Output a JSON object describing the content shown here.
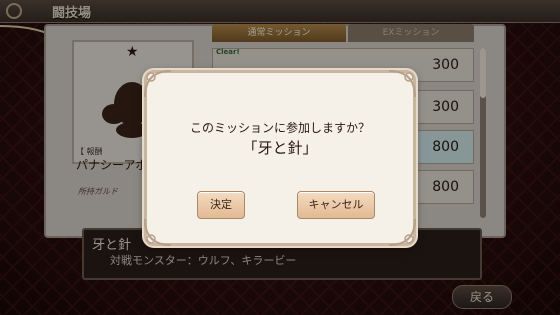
{
  "header": {
    "title": "闘技場"
  },
  "card": {
    "reward_label": "【 報酬",
    "reward_name": "パナシーアボ",
    "guild_label": "所持ガルド"
  },
  "tabs": [
    {
      "label": "通常ミッション"
    },
    {
      "label": "EXミッション"
    }
  ],
  "cleared_label": "Clear!",
  "missions": [
    {
      "value": "300"
    },
    {
      "value": "300"
    },
    {
      "value": "800"
    },
    {
      "value": "800"
    }
  ],
  "info": {
    "title": "牙と針",
    "description": "対戦モンスター：ウルフ、キラービー"
  },
  "back_button": "戻る",
  "dialog": {
    "question": "このミッションに参加しますか？",
    "mission_name": "「牙と針」",
    "ok_label": "決定",
    "cancel_label": "キャンセル"
  },
  "colors": {
    "highlight_row": "#cfe8ea",
    "button": "#e2b994",
    "background": "#2a0d0d"
  }
}
